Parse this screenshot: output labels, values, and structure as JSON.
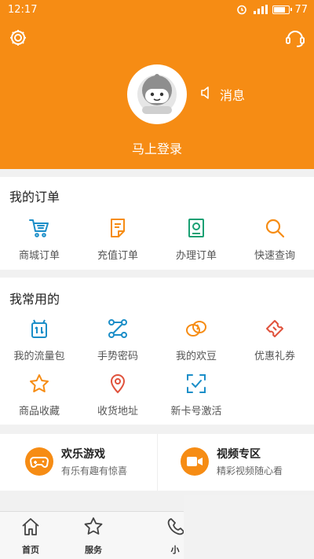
{
  "status_bar": {
    "time": "12:17",
    "battery": "77"
  },
  "header": {
    "message_label": "消息",
    "login_label": "马上登录",
    "background_color": "#f68c14"
  },
  "orders": {
    "title": "我的订单",
    "items": [
      {
        "label": "商城订单",
        "icon": "cart-icon",
        "color": "#1b8ec8"
      },
      {
        "label": "充值订单",
        "icon": "recharge-doc-icon",
        "color": "#f68c14"
      },
      {
        "label": "办理订单",
        "icon": "handle-doc-icon",
        "color": "#19a073"
      },
      {
        "label": "快速查询",
        "icon": "search-icon",
        "color": "#f68c14"
      }
    ]
  },
  "favorites": {
    "title": "我常用的",
    "items": [
      {
        "label": "我的流量包",
        "icon": "data-pack-icon",
        "color": "#1b8ec8"
      },
      {
        "label": "手势密码",
        "icon": "gesture-icon",
        "color": "#1b8ec8"
      },
      {
        "label": "我的欢豆",
        "icon": "beans-icon",
        "color": "#f68c14"
      },
      {
        "label": "优惠礼券",
        "icon": "coupon-icon",
        "color": "#e0523c"
      },
      {
        "label": "商品收藏",
        "icon": "star-icon",
        "color": "#f68c14"
      },
      {
        "label": "收货地址",
        "icon": "location-icon",
        "color": "#e0523c"
      },
      {
        "label": "新卡号激活",
        "icon": "scan-icon",
        "color": "#1b8ec8"
      }
    ]
  },
  "promos": [
    {
      "title": "欢乐游戏",
      "subtitle": "有乐有趣有惊喜",
      "icon": "gamepad-icon"
    },
    {
      "title": "视频专区",
      "subtitle": "精彩视频随心看",
      "icon": "video-icon"
    }
  ],
  "bottom_nav": [
    {
      "label": "首页",
      "icon": "home-icon"
    },
    {
      "label": "服务",
      "icon": "star-outline-icon"
    },
    {
      "label": "小",
      "icon": "phone-icon"
    }
  ]
}
